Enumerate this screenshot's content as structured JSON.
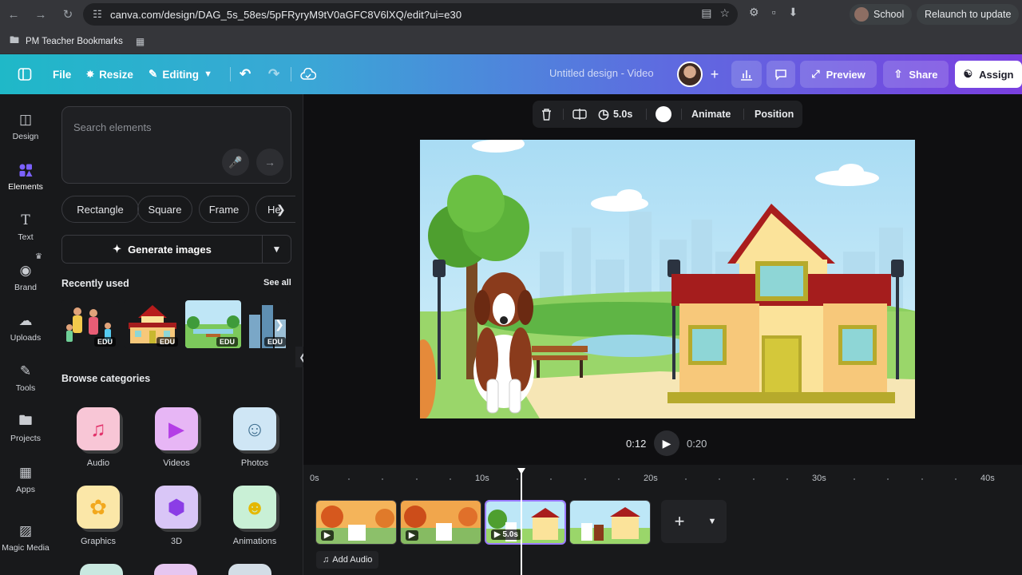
{
  "browser": {
    "url": "canva.com/design/DAG_5s_58es/5pFRyryM9tV0aGFC8V6lXQ/edit?ui=e30",
    "profile_label": "School",
    "relaunch_label": "Relaunch to update",
    "bookmark_folder": "PM Teacher Bookmarks"
  },
  "header": {
    "file_label": "File",
    "resize_label": "Resize",
    "editing_label": "Editing",
    "doc_title": "Untitled design - Video",
    "preview_label": "Preview",
    "share_label": "Share",
    "assign_label": "Assign"
  },
  "rail": {
    "items": [
      {
        "label": "Design",
        "icon": "design-icon"
      },
      {
        "label": "Elements",
        "icon": "elements-icon"
      },
      {
        "label": "Text",
        "icon": "text-icon"
      },
      {
        "label": "Brand",
        "icon": "brand-icon"
      },
      {
        "label": "Uploads",
        "icon": "uploads-icon"
      },
      {
        "label": "Tools",
        "icon": "tools-icon"
      },
      {
        "label": "Projects",
        "icon": "projects-icon"
      },
      {
        "label": "Apps",
        "icon": "apps-icon"
      },
      {
        "label": "Magic Media",
        "icon": "magic-media-icon"
      }
    ]
  },
  "panel": {
    "search_placeholder": "Search elements",
    "chips": [
      "Rectangle",
      "Square",
      "Frame",
      "He"
    ],
    "generate_label": "Generate images",
    "recently_used_title": "Recently used",
    "see_all_label": "See all",
    "edu_badge": "EDU",
    "browse_title": "Browse categories",
    "categories": [
      "Audio",
      "Videos",
      "Photos",
      "Graphics",
      "3D",
      "Animations"
    ]
  },
  "toolbar": {
    "duration": "5.0s",
    "animate_label": "Animate",
    "position_label": "Position"
  },
  "playback": {
    "current_time": "0:12",
    "total_time": "0:20"
  },
  "timeline": {
    "ticks": [
      "0s",
      "10s",
      "20s",
      "30s",
      "40s"
    ],
    "selected_clip_duration": "5.0s",
    "add_audio_label": "Add Audio"
  },
  "colors": {
    "accent": "#7b61ff",
    "header_start": "#1fb8c8",
    "header_end": "#7a3fe0"
  }
}
